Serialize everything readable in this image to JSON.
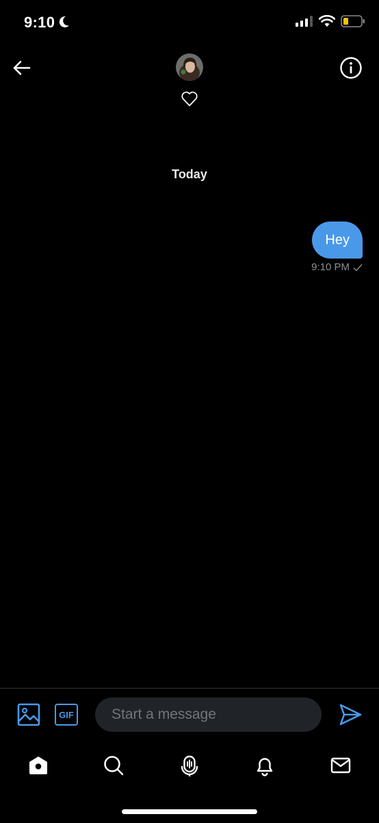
{
  "status_bar": {
    "time": "9:10"
  },
  "header": {
    "back_icon": "arrow-left-icon",
    "heart_icon": "heart-outline-icon",
    "info_icon": "info-icon"
  },
  "conversation": {
    "date_label": "Today",
    "messages": [
      {
        "text": "Hey",
        "time": "9:10 PM",
        "sent": true,
        "bubble_color": "#4a99e9"
      }
    ]
  },
  "composer": {
    "placeholder": "Start a message",
    "gif_label": "GIF",
    "accent_color": "#4a99e9"
  },
  "tabbar": {
    "items": [
      "home-icon",
      "search-icon",
      "spaces-icon",
      "notifications-icon",
      "messages-icon"
    ]
  }
}
